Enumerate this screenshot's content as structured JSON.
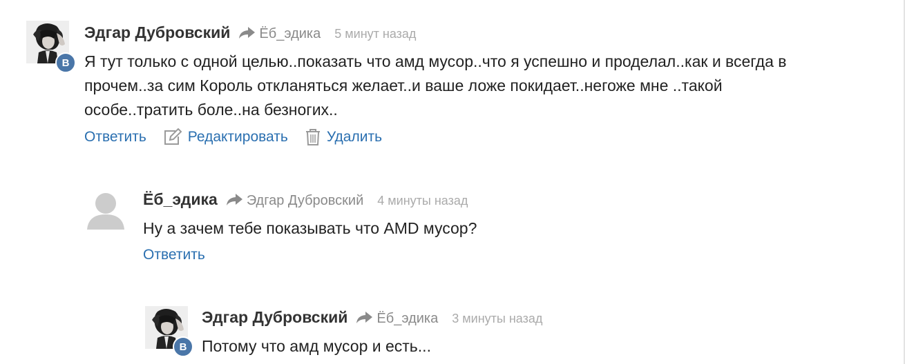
{
  "comments": [
    {
      "author": "Эдгар Дубровский",
      "reply_to": "Ёб_эдика",
      "time": "5 минут назад",
      "text_lines": [
        "Я тут только с одной целью..показать что амд мусор..что я успешно и проделал..как и всегда в",
        "прочем..за сим Король откланяться желает..и ваше ложе покидает..негоже мне ..такой",
        "особе..тратить боле..на безногих.."
      ],
      "badge": "B",
      "actions": {
        "reply": "Ответить",
        "edit": "Редактировать",
        "delete": "Удалить"
      }
    },
    {
      "author": "Ёб_эдика",
      "reply_to": "Эдгар Дубровский",
      "time": "4 минуты назад",
      "text": "Ну а зачем тебе показывать что AMD мусор?",
      "actions": {
        "reply": "Ответить"
      }
    },
    {
      "author": "Эдгар Дубровский",
      "reply_to": "Ёб_эдика",
      "time": "3 минуты назад",
      "text": "Потому что амд мусор и есть...",
      "badge": "B"
    }
  ],
  "colors": {
    "link": "#2a6fb0",
    "author": "#333333",
    "muted": "#8a8a8a",
    "time": "#aaaaaa",
    "vk_badge": "#4a76a8"
  },
  "icons": [
    "reply-arrow-icon",
    "pencil-edit-icon",
    "trash-icon",
    "vk-badge-icon",
    "default-user-avatar"
  ]
}
